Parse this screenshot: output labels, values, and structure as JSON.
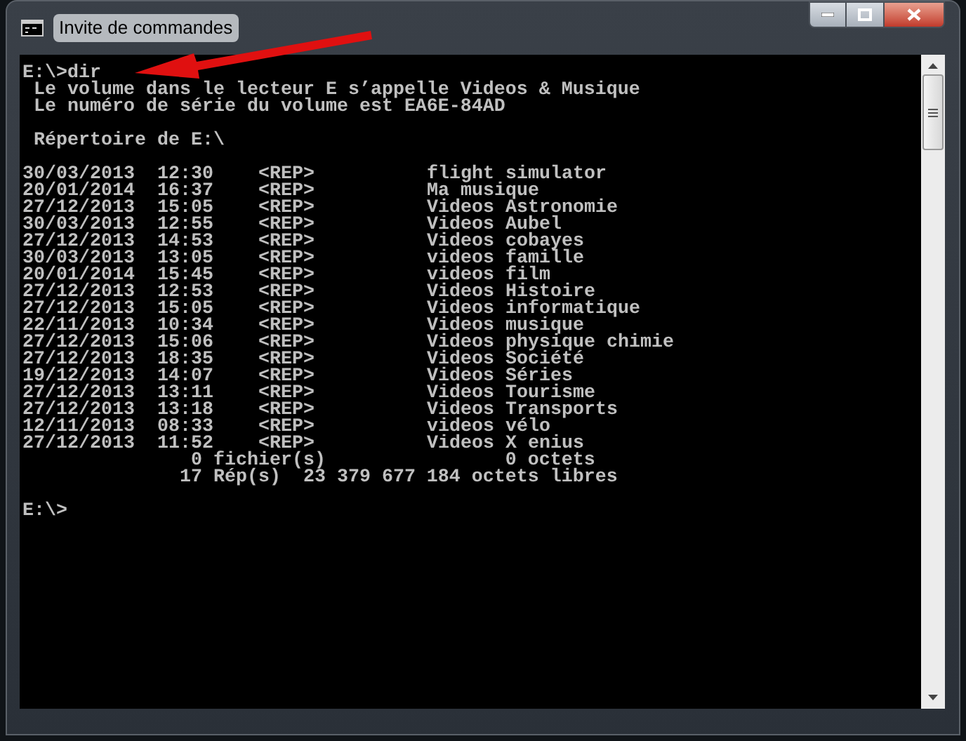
{
  "window": {
    "title": "Invite de commandes"
  },
  "console": {
    "command_line": "E:\\>dir",
    "header_lines": [
      " Le volume dans le lecteur E s’appelle Videos & Musique",
      " Le numéro de série du volume est EA6E-84AD"
    ],
    "directory_line": " Répertoire de E:\\",
    "entries": [
      {
        "date": "30/03/2013",
        "time": "12:30",
        "type": "<REP>",
        "name": "flight simulator"
      },
      {
        "date": "20/01/2014",
        "time": "16:37",
        "type": "<REP>",
        "name": "Ma musique"
      },
      {
        "date": "27/12/2013",
        "time": "15:05",
        "type": "<REP>",
        "name": "Videos Astronomie"
      },
      {
        "date": "30/03/2013",
        "time": "12:55",
        "type": "<REP>",
        "name": "Videos Aubel"
      },
      {
        "date": "27/12/2013",
        "time": "14:53",
        "type": "<REP>",
        "name": "Videos cobayes"
      },
      {
        "date": "30/03/2013",
        "time": "13:05",
        "type": "<REP>",
        "name": "videos famille"
      },
      {
        "date": "20/01/2014",
        "time": "15:45",
        "type": "<REP>",
        "name": "videos film"
      },
      {
        "date": "27/12/2013",
        "time": "12:53",
        "type": "<REP>",
        "name": "Videos Histoire"
      },
      {
        "date": "27/12/2013",
        "time": "15:05",
        "type": "<REP>",
        "name": "Videos informatique"
      },
      {
        "date": "22/11/2013",
        "time": "10:34",
        "type": "<REP>",
        "name": "Videos musique"
      },
      {
        "date": "27/12/2013",
        "time": "15:06",
        "type": "<REP>",
        "name": "Videos physique chimie"
      },
      {
        "date": "27/12/2013",
        "time": "18:35",
        "type": "<REP>",
        "name": "Videos Société"
      },
      {
        "date": "19/12/2013",
        "time": "14:07",
        "type": "<REP>",
        "name": "Videos Séries"
      },
      {
        "date": "27/12/2013",
        "time": "13:11",
        "type": "<REP>",
        "name": "Videos Tourisme"
      },
      {
        "date": "27/12/2013",
        "time": "13:18",
        "type": "<REP>",
        "name": "Videos Transports"
      },
      {
        "date": "12/11/2013",
        "time": "08:33",
        "type": "<REP>",
        "name": "videos vélo"
      },
      {
        "date": "27/12/2013",
        "time": "11:52",
        "type": "<REP>",
        "name": "Videos X enius"
      }
    ],
    "summary_lines": [
      "               0 fichier(s)                0 octets",
      "              17 Rép(s)  23 379 677 184 octets libres"
    ],
    "prompt": "E:\\>"
  }
}
